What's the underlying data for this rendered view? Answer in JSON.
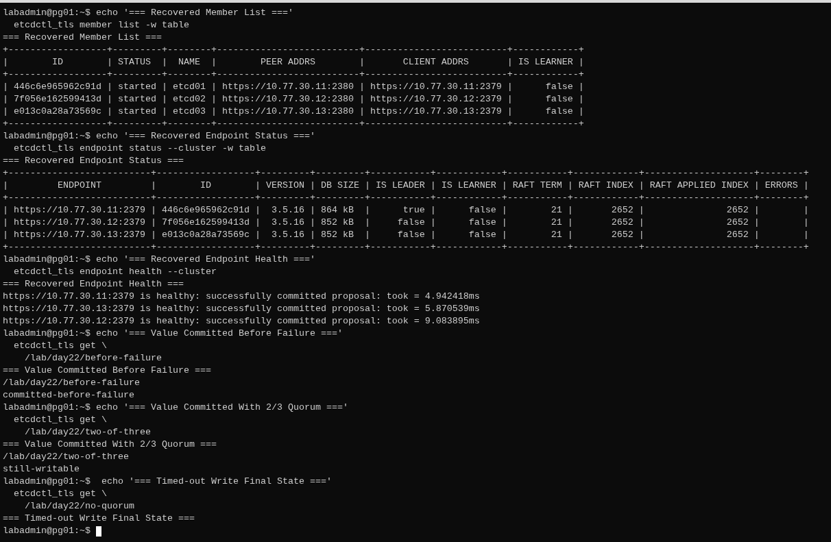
{
  "terminal": {
    "lines": [
      {
        "text": "labadmin@pg01:~$ echo '=== Recovered Member List ==='",
        "cursor": false
      },
      {
        "text": "  etcdctl_tls member list -w table",
        "cursor": false
      },
      {
        "text": "=== Recovered Member List ===",
        "cursor": false
      },
      {
        "text": "+------------------+---------+--------+--------------------------+--------------------------+------------+",
        "cursor": false
      },
      {
        "text": "|        ID        | STATUS  |  NAME  |        PEER ADDRS        |       CLIENT ADDRS       | IS LEARNER |",
        "cursor": false
      },
      {
        "text": "+------------------+---------+--------+--------------------------+--------------------------+------------+",
        "cursor": false
      },
      {
        "text": "| 446c6e965962c91d | started | etcd01 | https://10.77.30.11:2380 | https://10.77.30.11:2379 |      false |",
        "cursor": false
      },
      {
        "text": "| 7f056e162599413d | started | etcd02 | https://10.77.30.12:2380 | https://10.77.30.12:2379 |      false |",
        "cursor": false
      },
      {
        "text": "| e013c0a28a73569c | started | etcd03 | https://10.77.30.13:2380 | https://10.77.30.13:2379 |      false |",
        "cursor": false
      },
      {
        "text": "+------------------+---------+--------+--------------------------+--------------------------+------------+",
        "cursor": false
      },
      {
        "text": "labadmin@pg01:~$ echo '=== Recovered Endpoint Status ==='",
        "cursor": false
      },
      {
        "text": "  etcdctl_tls endpoint status --cluster -w table",
        "cursor": false
      },
      {
        "text": "=== Recovered Endpoint Status ===",
        "cursor": false
      },
      {
        "text": "+--------------------------+------------------+---------+---------+-----------+------------+-----------+------------+--------------------+--------+",
        "cursor": false
      },
      {
        "text": "|         ENDPOINT         |        ID        | VERSION | DB SIZE | IS LEADER | IS LEARNER | RAFT TERM | RAFT INDEX | RAFT APPLIED INDEX | ERRORS |",
        "cursor": false
      },
      {
        "text": "+--------------------------+------------------+---------+---------+-----------+------------+-----------+------------+--------------------+--------+",
        "cursor": false
      },
      {
        "text": "| https://10.77.30.11:2379 | 446c6e965962c91d |  3.5.16 | 864 kB  |      true |      false |        21 |       2652 |               2652 |        |",
        "cursor": false
      },
      {
        "text": "| https://10.77.30.12:2379 | 7f056e162599413d |  3.5.16 | 852 kB  |     false |      false |        21 |       2652 |               2652 |        |",
        "cursor": false
      },
      {
        "text": "| https://10.77.30.13:2379 | e013c0a28a73569c |  3.5.16 | 852 kB  |     false |      false |        21 |       2652 |               2652 |        |",
        "cursor": false
      },
      {
        "text": "+--------------------------+------------------+---------+---------+-----------+------------+-----------+------------+--------------------+--------+",
        "cursor": false
      },
      {
        "text": "labadmin@pg01:~$ echo '=== Recovered Endpoint Health ==='",
        "cursor": false
      },
      {
        "text": "  etcdctl_tls endpoint health --cluster",
        "cursor": false
      },
      {
        "text": "=== Recovered Endpoint Health ===",
        "cursor": false
      },
      {
        "text": "https://10.77.30.11:2379 is healthy: successfully committed proposal: took = 4.942418ms",
        "cursor": false
      },
      {
        "text": "https://10.77.30.13:2379 is healthy: successfully committed proposal: took = 5.870539ms",
        "cursor": false
      },
      {
        "text": "https://10.77.30.12:2379 is healthy: successfully committed proposal: took = 9.083895ms",
        "cursor": false
      },
      {
        "text": "labadmin@pg01:~$ echo '=== Value Committed Before Failure ==='",
        "cursor": false
      },
      {
        "text": "  etcdctl_tls get \\",
        "cursor": false
      },
      {
        "text": "    /lab/day22/before-failure",
        "cursor": false
      },
      {
        "text": "=== Value Committed Before Failure ===",
        "cursor": false
      },
      {
        "text": "/lab/day22/before-failure",
        "cursor": false
      },
      {
        "text": "committed-before-failure",
        "cursor": false
      },
      {
        "text": "labadmin@pg01:~$ echo '=== Value Committed With 2/3 Quorum ==='",
        "cursor": false
      },
      {
        "text": "  etcdctl_tls get \\",
        "cursor": false
      },
      {
        "text": "    /lab/day22/two-of-three",
        "cursor": false
      },
      {
        "text": "=== Value Committed With 2/3 Quorum ===",
        "cursor": false
      },
      {
        "text": "/lab/day22/two-of-three",
        "cursor": false
      },
      {
        "text": "still-writable",
        "cursor": false
      },
      {
        "text": "labadmin@pg01:~$  echo '=== Timed-out Write Final State ==='",
        "cursor": false
      },
      {
        "text": "  etcdctl_tls get \\",
        "cursor": false
      },
      {
        "text": "    /lab/day22/no-quorum",
        "cursor": false
      },
      {
        "text": "=== Timed-out Write Final State ===",
        "cursor": false
      },
      {
        "text": "labadmin@pg01:~$",
        "cursor": true
      }
    ]
  }
}
